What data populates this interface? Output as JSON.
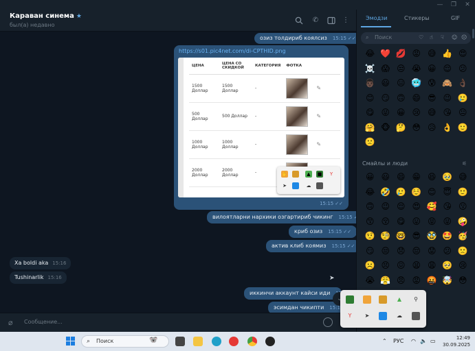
{
  "chat": {
    "title": "Караван синема",
    "status": "был(а) недавно",
    "composer_placeholder": "Сообщение..."
  },
  "messages": {
    "m1": {
      "text": "озиз толдириб коялсиз",
      "time": "15:15"
    },
    "link": {
      "url": "https://s01.pic4net.com/di-CPTHID.png",
      "time": "15:15"
    },
    "m2": {
      "text": "вилоятларни нархики озгартириб чикинг",
      "time": "15:15"
    },
    "m3": {
      "text": "криб озиз",
      "time": "15:15"
    },
    "m4": {
      "text": "актив клиб коямиз",
      "time": "15:15"
    },
    "in1": {
      "text": "Xa boldi aka",
      "time": "15:16"
    },
    "in2": {
      "text": "Tushinarlik",
      "time": "15:16"
    },
    "m5": {
      "text": "иккинчи аккаунт кайси иди",
      "time": "15:1"
    },
    "m6": {
      "text": "эсимдан чикипти",
      "time": "15:16"
    }
  },
  "preview_table": {
    "headers": [
      "ЦЕНА",
      "ЦЕНА СО СКИДКОЙ",
      "КАТЕГОРИЯ",
      "ФОТКА"
    ],
    "rows": [
      {
        "price": "1500 Доллар",
        "discount": "1500 Доллар",
        "category": "-"
      },
      {
        "price": "500 Доллар",
        "discount": "500 Доллар",
        "category": "-"
      },
      {
        "price": "1000 Доллар",
        "discount": "1000 Доллар",
        "category": "-"
      },
      {
        "price": "2000 Доллар",
        "discount": "2000 Доллар",
        "category": "-"
      }
    ]
  },
  "panel": {
    "tabs": [
      "Эмодзи",
      "Стикеры",
      "GIF"
    ],
    "search_placeholder": "Поиск",
    "section_title": "Смайлы и люди",
    "recent": [
      "😂",
      "❤️",
      "💋",
      "😡",
      "😅",
      "👍",
      "😍",
      "☠️",
      "😱",
      "😒",
      "😭",
      "😀",
      "😌",
      "😕",
      "👨🏿",
      "😃",
      "😑",
      "🥶",
      "😰",
      "🙈",
      "👌🏿",
      "😊",
      "😏",
      "🙃",
      "😄",
      "😎",
      "😉",
      "🥲",
      "😋",
      "😜",
      "😀",
      "😢",
      "😅",
      "😘",
      "😐",
      "🤗",
      "🐵",
      "🤔",
      "😳",
      "😥",
      "👌",
      "🙂",
      "🙁"
    ],
    "people": [
      "😀",
      "😃",
      "😄",
      "😁",
      "😆",
      "🥹",
      "😅",
      "😂",
      "🤣",
      "🥲",
      "☺️",
      "😊",
      "😇",
      "🙂",
      "🙃",
      "😉",
      "😌",
      "😍",
      "🥰",
      "😘",
      "😗",
      "😙",
      "😚",
      "😋",
      "😛",
      "😝",
      "😜",
      "🤪",
      "🤨",
      "🧐",
      "🤓",
      "😎",
      "🥸",
      "🤩",
      "🥳",
      "😏",
      "😒",
      "😞",
      "😔",
      "😟",
      "😕",
      "🙁",
      "☹️",
      "😣",
      "😖",
      "😫",
      "😩",
      "🥺",
      "😢",
      "😭",
      "😤",
      "😠",
      "😡",
      "🤬",
      "🤯",
      "😳",
      "🥵",
      "🥶",
      "😱",
      "😨"
    ]
  },
  "taskbar": {
    "search_label": "Поиск",
    "language": "РУС",
    "time": "12:49",
    "date": "30.09.2025"
  },
  "colors": {
    "chat_bg": "#0e1621",
    "outgoing_bubble": "#2b5278",
    "incoming_bubble": "#182533",
    "accent": "#5fa7e3"
  }
}
